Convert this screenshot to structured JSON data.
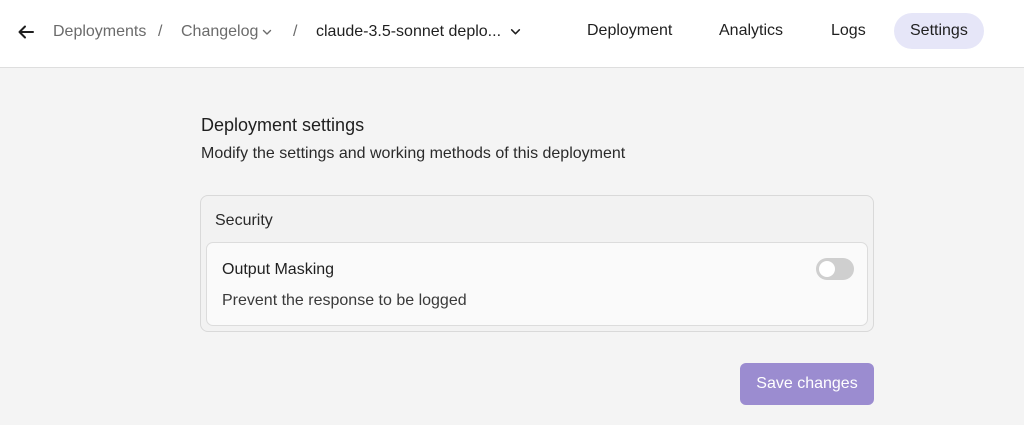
{
  "header": {
    "breadcrumb": {
      "items": [
        "Deployments",
        "Changelog",
        "claude-3.5-sonnet deplo..."
      ],
      "separator": "/"
    },
    "tabs": [
      {
        "label": "Deployment"
      },
      {
        "label": "Analytics"
      },
      {
        "label": "Logs"
      },
      {
        "label": "Settings",
        "active": true
      }
    ]
  },
  "main": {
    "title": "Deployment settings",
    "description": "Modify the settings and working methods of this deployment",
    "security": {
      "title": "Security",
      "output_masking": {
        "title": "Output Masking",
        "description": "Prevent the response to be logged",
        "enabled": false
      }
    },
    "save_label": "Save changes"
  },
  "colors": {
    "accent": "#9b8cd0",
    "active_tab_bg": "#e6e6f8",
    "page_bg": "#f4f4f4"
  },
  "icons": {
    "back": "arrow-left-icon",
    "dropdown": "chevron-down-icon"
  }
}
